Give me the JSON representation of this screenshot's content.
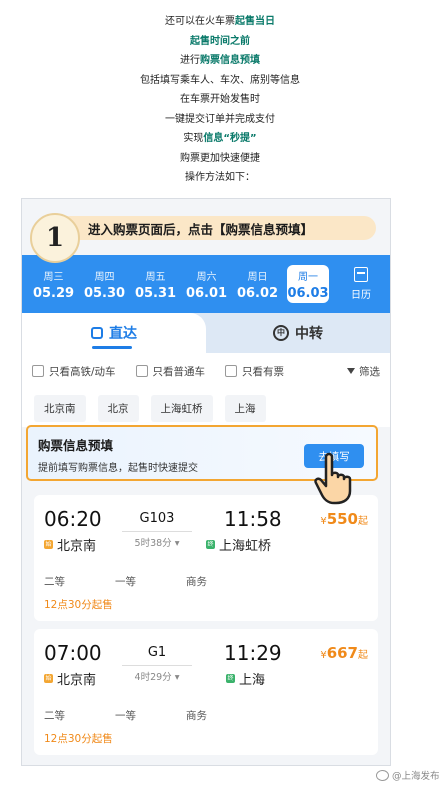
{
  "intro": {
    "line1_a": "还可以在火车票",
    "line1_b": "起售当日",
    "line2": "起售时间之前",
    "line3_a": "进行",
    "line3_b": "购票信息预填",
    "line4": "包括填写乘车人、车次、席别等信息",
    "line5": "在车票开始发售时",
    "line6": "一键提交订单并完成支付",
    "line7_a": "实现",
    "line7_b": "信息“秒提”",
    "line8": "购票更加快速便捷",
    "line9": "操作方法如下："
  },
  "step": {
    "number": "1",
    "text": "进入购票页面后，点击【购票信息预填】"
  },
  "dates": [
    {
      "weekday": "周三",
      "date": "05.29"
    },
    {
      "weekday": "周四",
      "date": "05.30"
    },
    {
      "weekday": "周五",
      "date": "05.31"
    },
    {
      "weekday": "周六",
      "date": "06.01"
    },
    {
      "weekday": "周日",
      "date": "06.02"
    },
    {
      "weekday": "周一",
      "date": "06.03"
    }
  ],
  "calendar_label": "日历",
  "tabs": {
    "direct": "直达",
    "transfer": "中转",
    "transfer_icon": "中"
  },
  "filters": {
    "gaotie": "只看高铁/动车",
    "putong": "只看普通车",
    "youpiao": "只看有票",
    "screen": "筛选"
  },
  "stations": [
    "北京南",
    "北京",
    "上海虹桥",
    "上海"
  ],
  "prefill": {
    "title": "购票信息预填",
    "subtitle": "提前填写购票信息，起售时快速提交",
    "button": "去填写"
  },
  "trains": [
    {
      "depart_time": "06:20",
      "code": "G103",
      "duration": "5时38分",
      "arrive_time": "11:58",
      "from": "北京南",
      "to": "上海虹桥",
      "price_symbol": "¥",
      "price": "550",
      "price_suffix": "起",
      "seat1": "二等",
      "seat2": "一等",
      "seat3": "商务",
      "sale": "12点30分起售",
      "from_tag": "始",
      "to_tag": "终"
    },
    {
      "depart_time": "07:00",
      "code": "G1",
      "duration": "4时29分",
      "arrive_time": "11:29",
      "from": "北京南",
      "to": "上海",
      "price_symbol": "¥",
      "price": "667",
      "price_suffix": "起",
      "seat1": "二等",
      "seat2": "一等",
      "seat3": "商务",
      "sale": "12点30分起售",
      "from_tag": "始",
      "to_tag": "终"
    }
  ],
  "watermark": "@上海发布",
  "colors": {
    "accent": "#2f8ff0",
    "highlight_text": "#0a7a6a",
    "price": "#f08a1a",
    "border_highlight": "#f3a632"
  }
}
